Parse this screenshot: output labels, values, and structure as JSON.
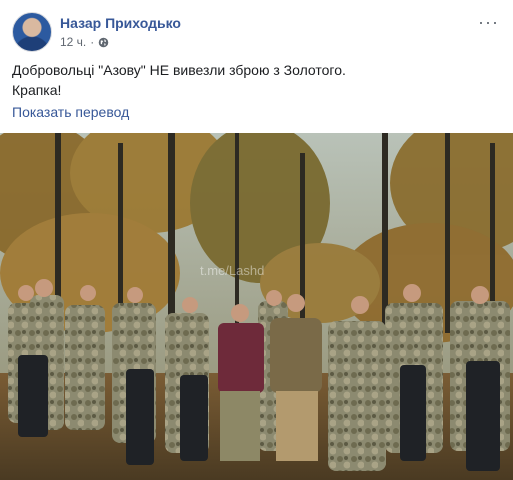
{
  "post": {
    "author": "Назар Приходько",
    "time": "12 ч.",
    "separator": "·",
    "privacy_icon": "globe-icon",
    "more_icon": "more-horizontal-icon",
    "more_glyph": "···",
    "text_line1": "Добровольці \"Азову\" НЕ вивезли зброю з Золотого.",
    "text_line2": "Крапка!",
    "translate_label": "Показать перевод",
    "photo_watermark": "t.me/Lashd"
  },
  "colors": {
    "link": "#385898",
    "meta": "#606770",
    "text": "#1c1e21"
  }
}
